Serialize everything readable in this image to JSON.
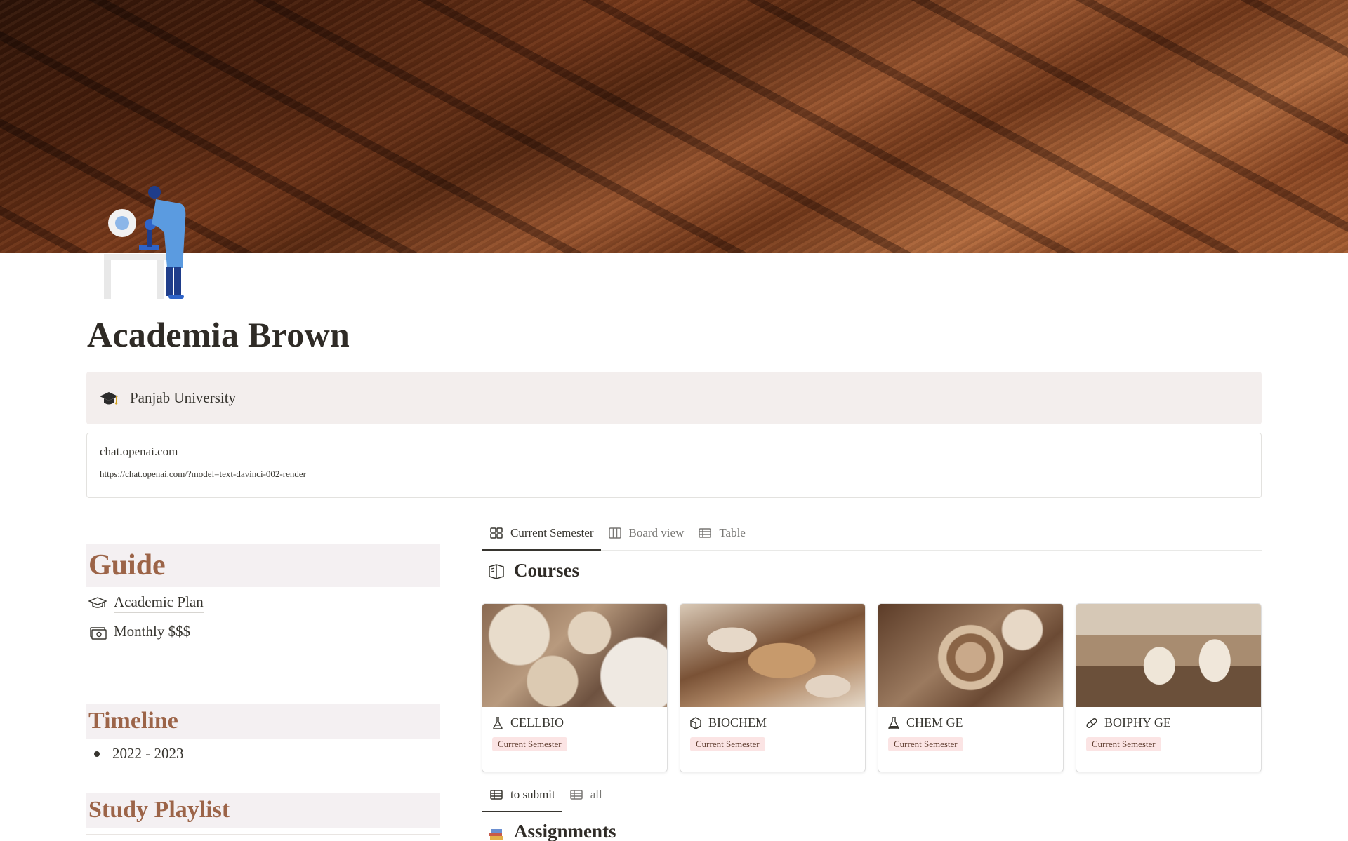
{
  "page": {
    "title": "Academia Brown",
    "cover_icon": "scientist-microscope-illustration"
  },
  "callout": {
    "icon": "graduation-cap-icon",
    "text": "Panjab University"
  },
  "bookmark": {
    "title": "chat.openai.com",
    "url": "https://chat.openai.com/?model=text-davinci-002-render"
  },
  "guide": {
    "heading": "Guide",
    "links": [
      {
        "icon": "mortarboard-icon",
        "label": "Academic Plan"
      },
      {
        "icon": "money-icon",
        "label": "Monthly $$$"
      }
    ]
  },
  "timeline": {
    "heading": "Timeline",
    "items": [
      "2022 - 2023"
    ]
  },
  "playlist": {
    "heading": "Study Playlist"
  },
  "courses": {
    "tabs": [
      {
        "icon": "gallery-icon",
        "label": "Current Semester",
        "active": true
      },
      {
        "icon": "board-icon",
        "label": "Board view",
        "active": false
      },
      {
        "icon": "table-icon",
        "label": "Table",
        "active": false
      }
    ],
    "title": "Courses",
    "cards": [
      {
        "icon": "flask-icon",
        "name": "CELLBIO",
        "tag": "Current Semester"
      },
      {
        "icon": "hexagon-icon",
        "name": "BIOCHEM",
        "tag": "Current Semester"
      },
      {
        "icon": "beaker-icon",
        "name": "CHEM GE",
        "tag": "Current Semester"
      },
      {
        "icon": "pill-icon",
        "name": "BOIPHY GE",
        "tag": "Current Semester"
      }
    ]
  },
  "assignments": {
    "tabs": [
      {
        "icon": "table-icon",
        "label": "to submit",
        "active": true
      },
      {
        "icon": "table-icon",
        "label": "all",
        "active": false
      }
    ],
    "title": "Assignments"
  },
  "colors": {
    "heading_accent": "#9c6448",
    "callout_bg": "#f3eeed",
    "section_bg": "#f4f0f2",
    "tag_bg": "#fbe4e4"
  }
}
